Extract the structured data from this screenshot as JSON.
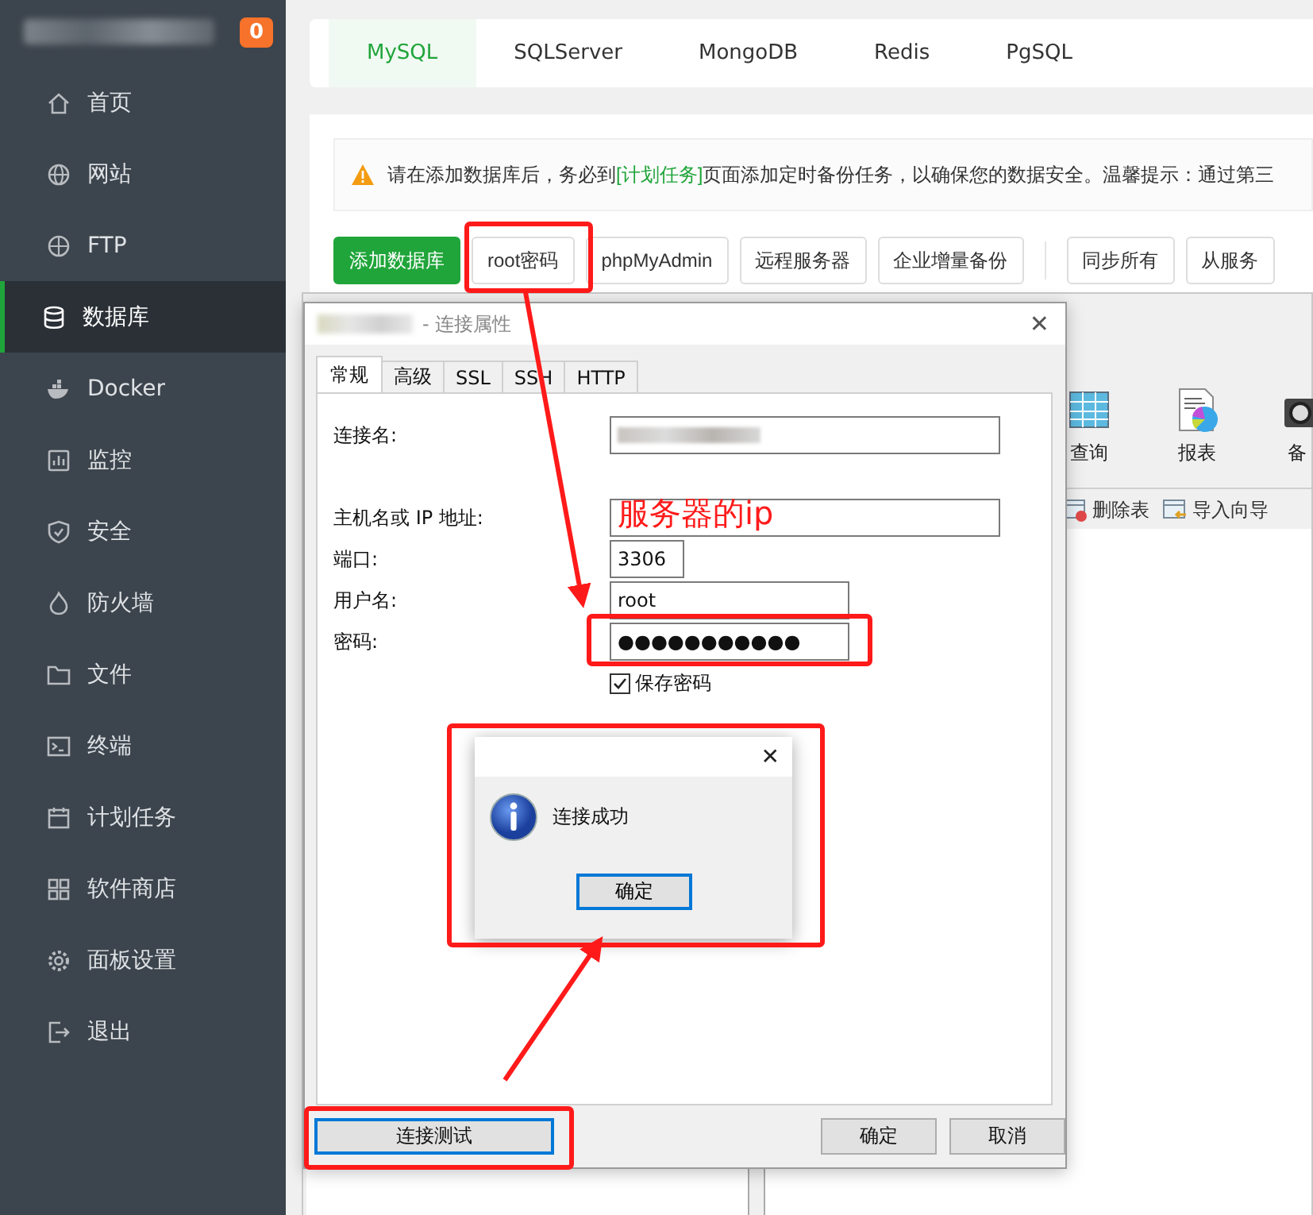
{
  "sidebar": {
    "badge": "0",
    "items": [
      {
        "label": "首页",
        "selected": false
      },
      {
        "label": "网站",
        "selected": false
      },
      {
        "label": "FTP",
        "selected": false
      },
      {
        "label": "数据库",
        "selected": true
      },
      {
        "label": "Docker",
        "selected": false
      },
      {
        "label": "监控",
        "selected": false
      },
      {
        "label": "安全",
        "selected": false
      },
      {
        "label": "防火墙",
        "selected": false
      },
      {
        "label": "文件",
        "selected": false
      },
      {
        "label": "终端",
        "selected": false
      },
      {
        "label": "计划任务",
        "selected": false
      },
      {
        "label": "软件商店",
        "selected": false
      },
      {
        "label": "面板设置",
        "selected": false
      },
      {
        "label": "退出",
        "selected": false
      }
    ]
  },
  "db_tabs": [
    {
      "label": "MySQL",
      "selected": true
    },
    {
      "label": "SQLServer",
      "selected": false
    },
    {
      "label": "MongoDB",
      "selected": false
    },
    {
      "label": "Redis",
      "selected": false
    },
    {
      "label": "PgSQL",
      "selected": false
    }
  ],
  "notice": {
    "before": "请在添加数据库后，务必到",
    "link": "[计划任务]",
    "after": "页面添加定时备份任务，以确保您的数据安全。温馨提示：通过第三"
  },
  "toolbar": [
    {
      "label": "添加数据库",
      "kind": "primary"
    },
    {
      "label": "root密码",
      "kind": "default"
    },
    {
      "label": "phpMyAdmin",
      "kind": "default"
    },
    {
      "label": "远程服务器",
      "kind": "default"
    },
    {
      "label": "企业增量备份",
      "kind": "default"
    },
    {
      "kind": "divider"
    },
    {
      "label": "同步所有",
      "kind": "default"
    },
    {
      "label": "从服务",
      "kind": "default"
    }
  ],
  "navicat": {
    "tools": [
      {
        "label": "查询"
      },
      {
        "label": "报表"
      },
      {
        "label": "备"
      }
    ],
    "actions": [
      {
        "label": "删除表"
      },
      {
        "label": "导入向导"
      }
    ]
  },
  "dialog": {
    "title": "- 连接属性",
    "close": "✕",
    "tabs": [
      {
        "label": "常规",
        "selected": true
      },
      {
        "label": "高级",
        "selected": false
      },
      {
        "label": "SSL",
        "selected": false
      },
      {
        "label": "SSH",
        "selected": false
      },
      {
        "label": "HTTP",
        "selected": false
      }
    ],
    "fields": [
      {
        "label": "连接名:",
        "redacted": true
      },
      {
        "label": "主机名或 IP 地址:",
        "redacted": true
      },
      {
        "label": "端口:",
        "value": "3306"
      },
      {
        "label": "用户名:",
        "value": "root"
      },
      {
        "label": "密码:",
        "value": "●●●●●●●●●●●"
      }
    ],
    "save_password": {
      "label": "保存密码",
      "checked": true
    },
    "test_button": "连接测试",
    "buttons": [
      {
        "label": "确定"
      },
      {
        "label": "取消"
      }
    ]
  },
  "message_box": {
    "close": "✕",
    "text": "连接成功",
    "button": "确定"
  },
  "annotation": {
    "text": "服务器的ip"
  }
}
